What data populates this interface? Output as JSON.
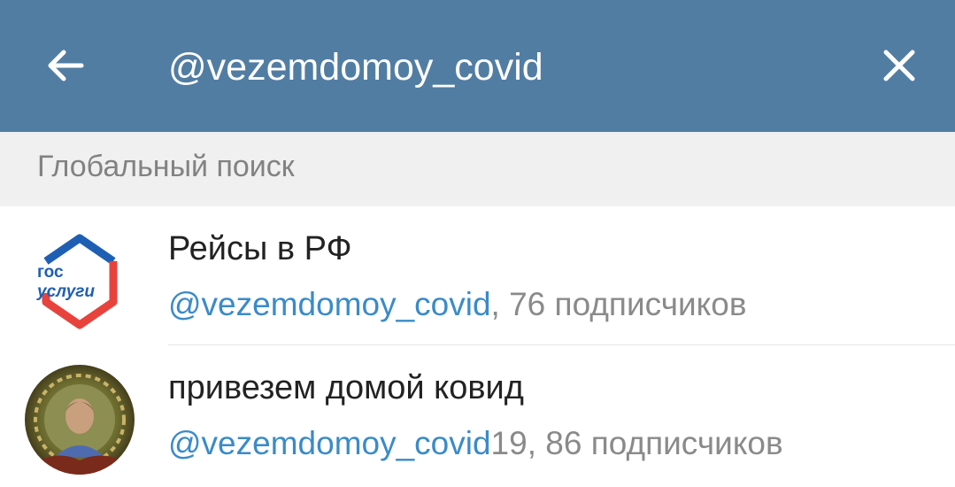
{
  "colors": {
    "header_bg": "#527da3",
    "link": "#3a8bc9",
    "section_bg": "#f0f0f0"
  },
  "header": {
    "back_icon": "arrow-left-icon",
    "search_query": "@vezemdomoy_covid",
    "close_icon": "close-icon"
  },
  "section": {
    "title": "Глобальный поиск"
  },
  "results": [
    {
      "title": "Рейсы в РФ",
      "handle": "@vezemdomoy_covid",
      "suffix": ", 76 подписчиков",
      "avatar_icon": "gosuslugi-logo",
      "avatar_text_line1": "гос",
      "avatar_text_line2": "услуги"
    },
    {
      "title": "привезем домой ковид",
      "handle": "@vezemdomoy_covid",
      "suffix": "19, 86 подписчиков",
      "avatar_icon": "user-photo-avatar"
    }
  ]
}
